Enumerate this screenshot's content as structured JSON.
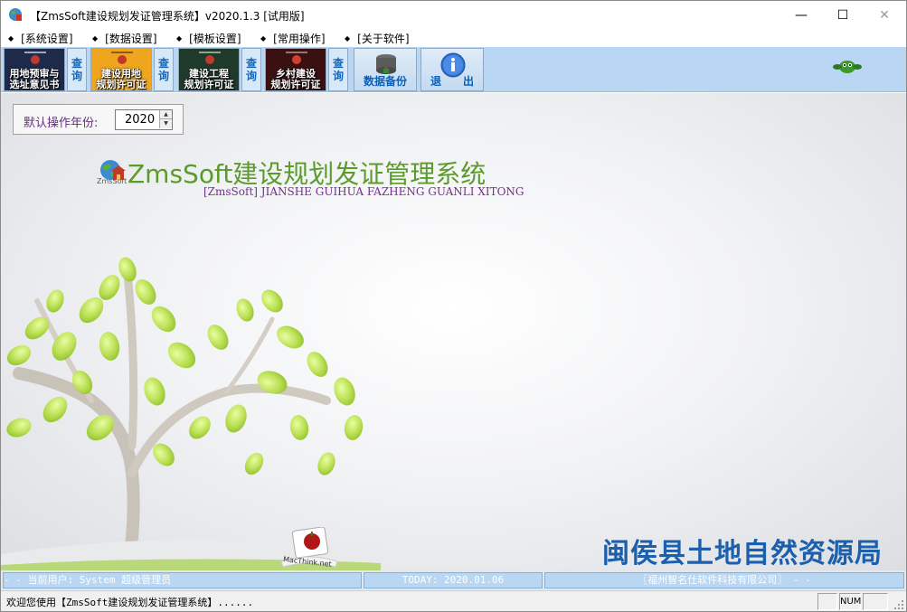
{
  "window": {
    "title": "【ZmsSoft建设规划发证管理系统】v2020.1.3 [试用版]",
    "controls": {
      "minimize": "—",
      "maximize": "☐",
      "close": "✕"
    }
  },
  "menu": {
    "items": [
      {
        "label": "[系统设置]"
      },
      {
        "label": "[数据设置]"
      },
      {
        "label": "[模板设置]"
      },
      {
        "label": "[常用操作]"
      },
      {
        "label": "[关于软件]"
      }
    ],
    "bullet": "◆"
  },
  "toolbar": {
    "buttons": [
      {
        "line1": "用地预审与",
        "line2": "选址意见书",
        "bg": "#1d2a4a"
      },
      {
        "line1": "建设用地",
        "line2": "规划许可证",
        "bg": "#f0a51e"
      },
      {
        "line1": "建设工程",
        "line2": "规划许可证",
        "bg": "#1f3a2a"
      },
      {
        "line1": "乡村建设",
        "line2": "规划许可证",
        "bg": "#3a1010"
      }
    ],
    "query_label_top": "查",
    "query_label_bottom": "询",
    "backup_label": "数据备份",
    "exit_label": "退　　出"
  },
  "year_setting": {
    "label": "默认操作年份:",
    "value": "2020"
  },
  "branding": {
    "app_name": "ZmsSoft建设规划发证管理系统",
    "subtitle": "[ZmsSoft] JIANSHE GUIHUA FAZHENG GUANLI XITONG",
    "agency": "闽侯县土地自然资源局",
    "badge_text": "MacThink.net",
    "logo_caption": "ZmsSoft"
  },
  "status_bar": {
    "user_text": " - -  当前用户: System   超级管理员",
    "date_text": "TODAY: 2020.01.06",
    "company_text": "〖福州智名仕软件科技有限公司〗 - -",
    "message": "欢迎您使用【ZmsSoft建设规划发证管理系统】......",
    "num_indicator": "NUM"
  },
  "colors": {
    "toolbar_bg": "#b9d6f3",
    "app_name": "#5c9a2c",
    "subtitle": "#7a2a98",
    "agency": "#1b5fad"
  }
}
